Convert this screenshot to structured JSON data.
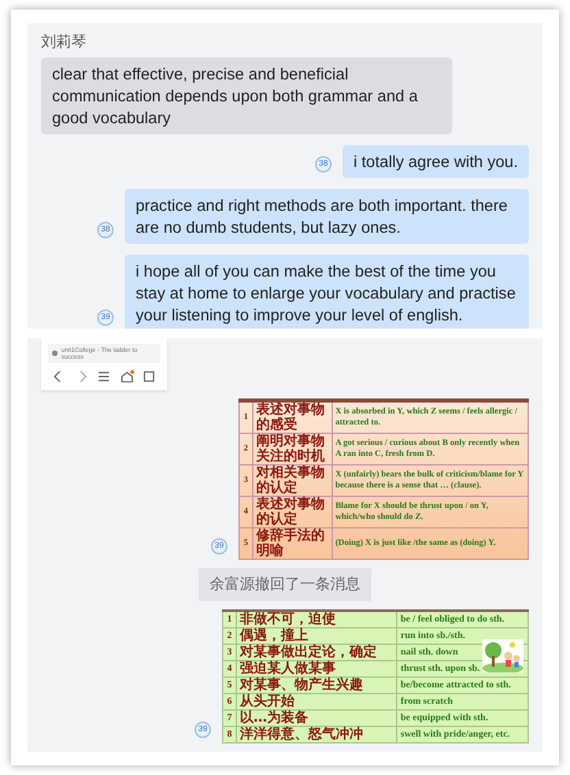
{
  "sender": "刘莉琴",
  "chat_top": [
    {
      "kind": "received",
      "text": "clear that effective, precise and beneficial communication depends upon both grammar and a good vocabulary"
    },
    {
      "kind": "sent",
      "read_count": "38",
      "text": "i totally agree with you."
    },
    {
      "kind": "sent",
      "read_count": "38",
      "text": "practice and right methods are both important. there are no dumb students, but lazy ones."
    },
    {
      "kind": "sent",
      "read_count": "39",
      "text": "i hope all of you can make the best of the time you stay at home to enlarge your vocabulary and practise your listening to improve your level of english."
    }
  ],
  "shared_card": {
    "title": "unit1College - The ladder to success"
  },
  "chat_bottom": [
    {
      "kind": "table",
      "read_count": "39",
      "color": "#f9c49a",
      "rows": [
        {
          "number": "1",
          "chinese": "表述对事物的感受",
          "english": "X is absorbed in Y, which Z seems / feels allergic / attracted to."
        },
        {
          "number": "2",
          "chinese": "阐明对事物关注的时机",
          "english": "A got serious / curious about B only recently when A ran into C, fresh from D."
        },
        {
          "number": "3",
          "chinese": "对相关事物的认定",
          "english": "X (unfairly) bears the bulk of criticism/blame for Y because there is a sense that … (clause)."
        },
        {
          "number": "4",
          "chinese": "表述对事物的认定",
          "english": "Blame for X should be thrust upon / on Y, which/who should do Z."
        },
        {
          "number": "5",
          "chinese": "修辞手法的明喻",
          "english": "(Doing) X is just like /the same as (doing) Y."
        }
      ]
    },
    {
      "kind": "notice",
      "text": "余富源撤回了一条消息"
    },
    {
      "kind": "table",
      "read_count": "39",
      "color": "#d8f5b6",
      "rows": [
        {
          "number": "1",
          "chinese": "非做不可，迫使",
          "english": "be / feel obliged to do sth."
        },
        {
          "number": "2",
          "chinese": "偶遇，撞上",
          "english": "run into sb./sth."
        },
        {
          "number": "3",
          "chinese": "对某事做出定论，确定",
          "english": "nail sth. down"
        },
        {
          "number": "4",
          "chinese": "强迫某人做某事",
          "english": "thrust sth. upon sb."
        },
        {
          "number": "5",
          "chinese": "对某事、物产生兴趣",
          "english": "be/become attracted to sth."
        },
        {
          "number": "6",
          "chinese": "从头开始",
          "english": "from scratch"
        },
        {
          "number": "7",
          "chinese": "以…为装备",
          "english": "be equipped with sth."
        },
        {
          "number": "8",
          "chinese": "洋洋得意、怒气冲冲",
          "english": "swell with pride/anger, etc."
        }
      ]
    }
  ]
}
